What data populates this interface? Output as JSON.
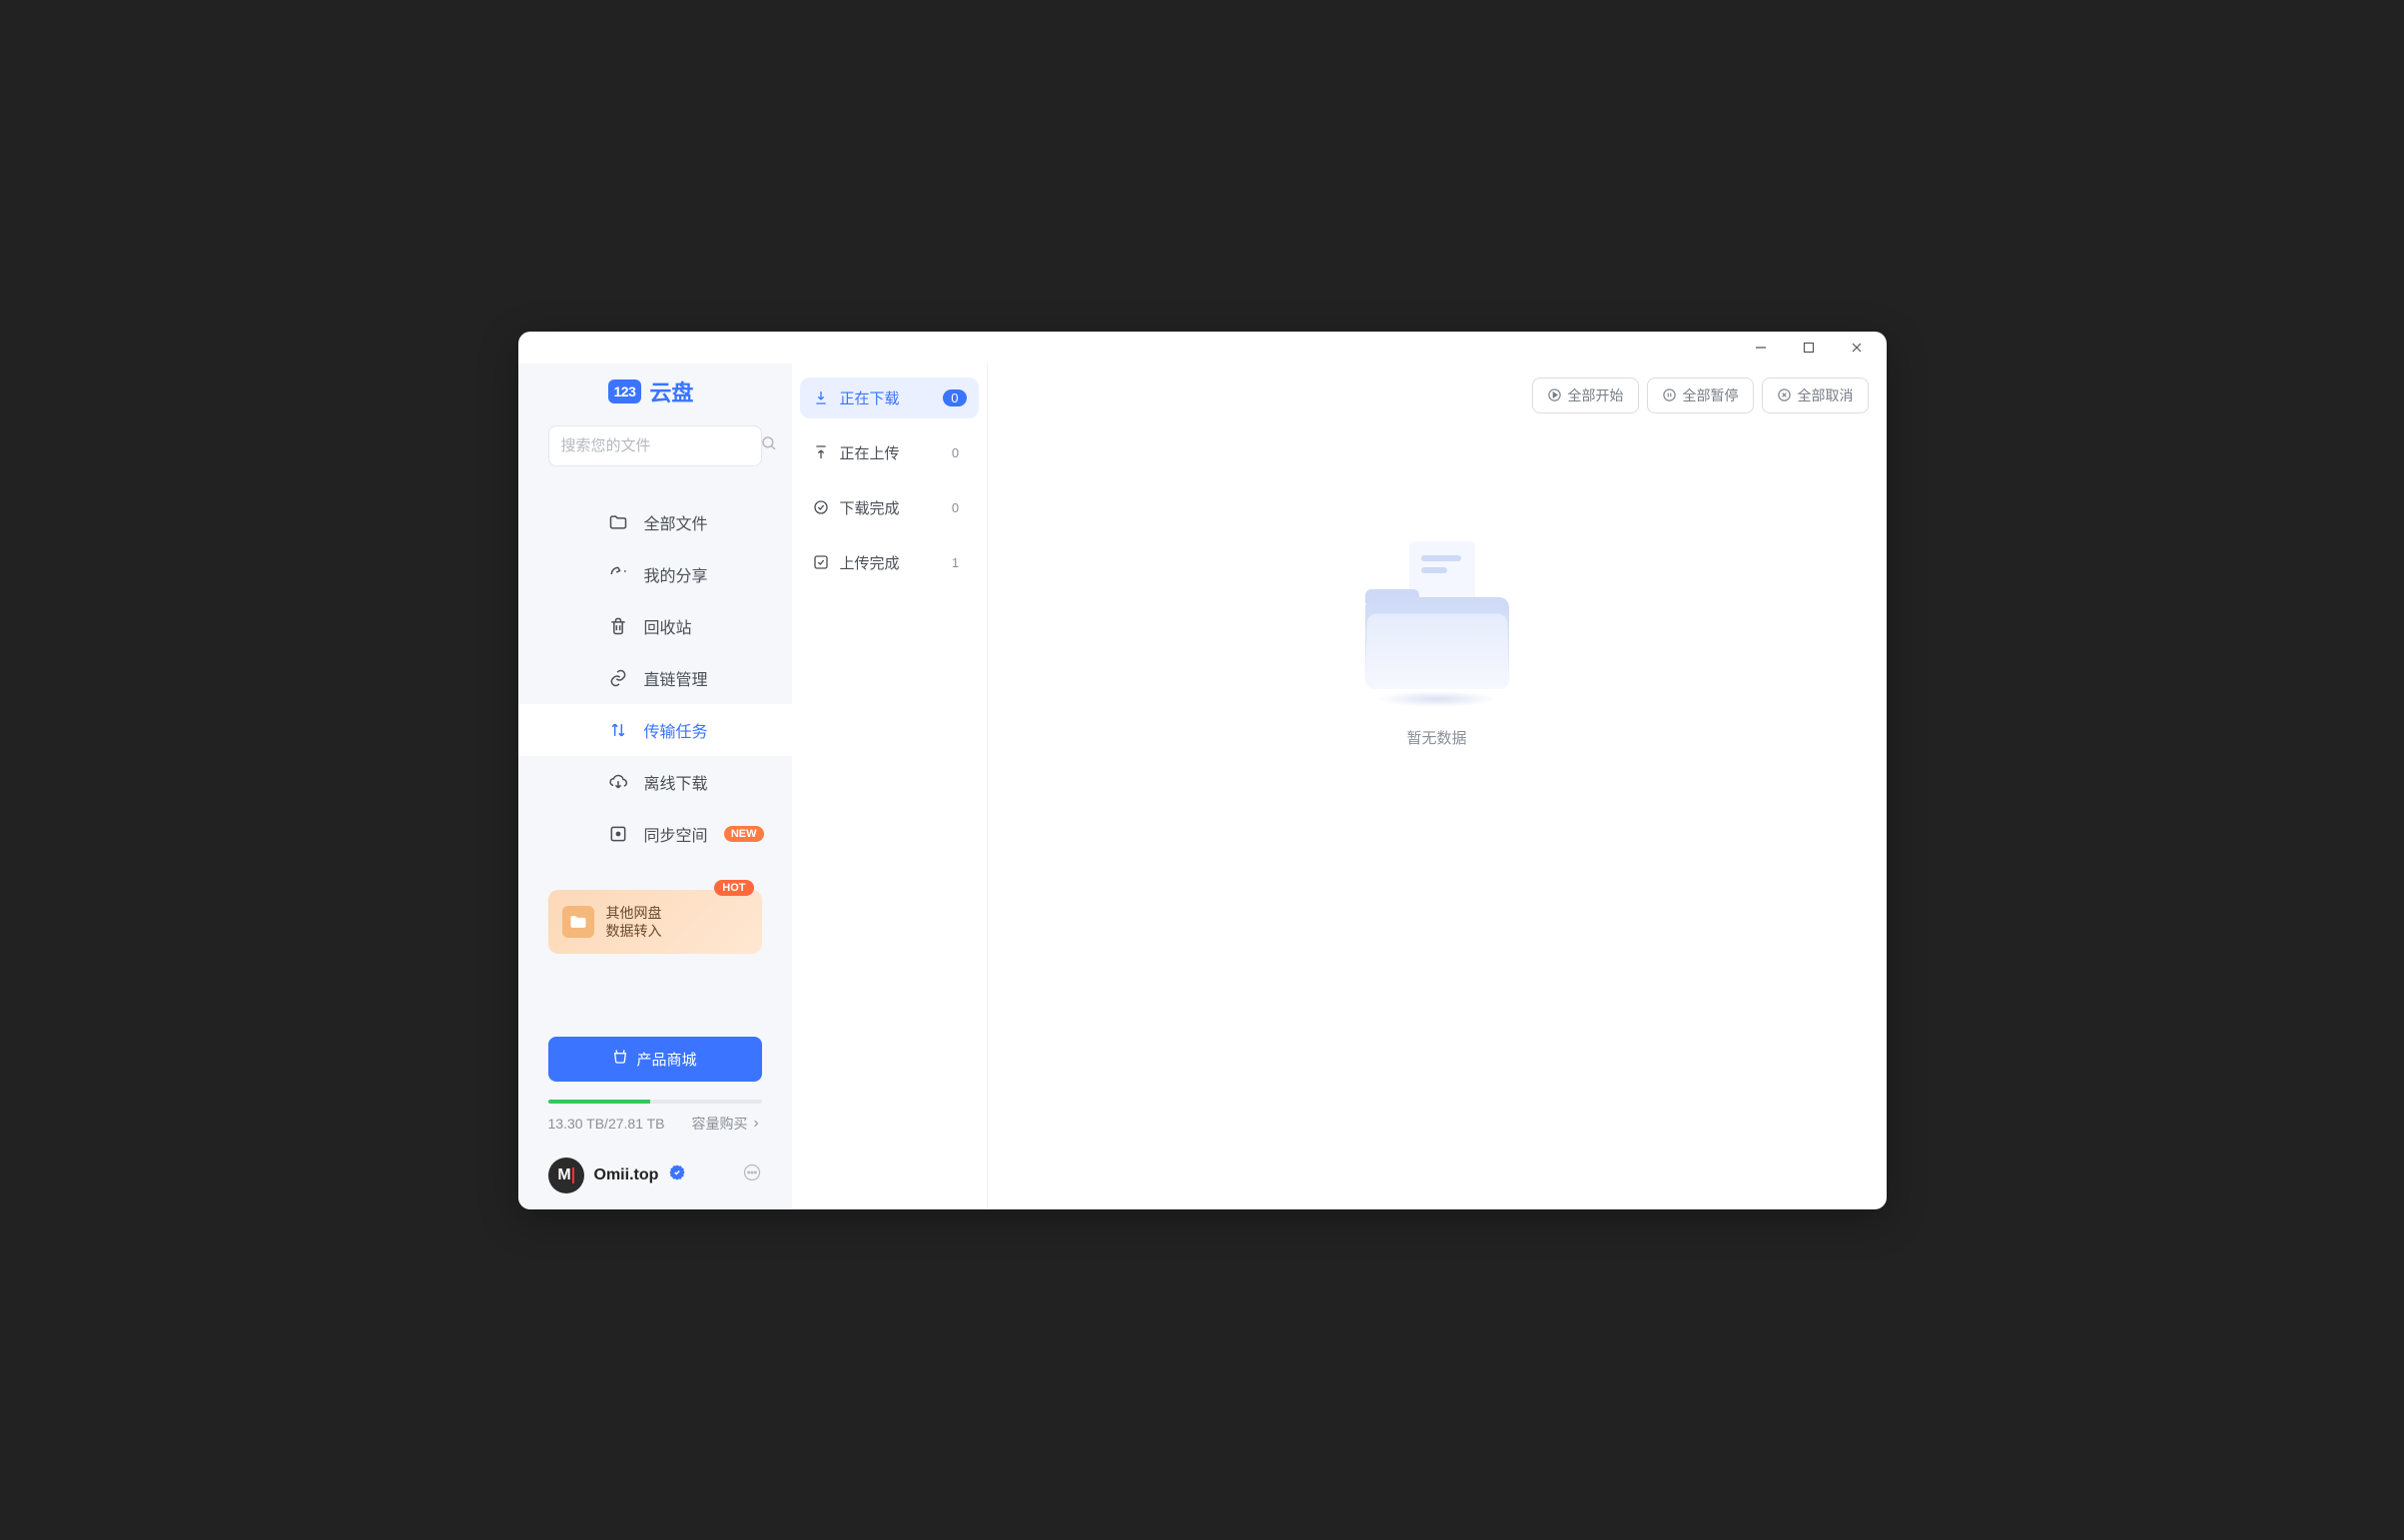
{
  "logo": {
    "badge": "123",
    "text": "云盘"
  },
  "search": {
    "placeholder": "搜索您的文件"
  },
  "nav": {
    "all_files": "全部文件",
    "my_shares": "我的分享",
    "recycle": "回收站",
    "direct_links": "直链管理",
    "transfer_tasks": "传输任务",
    "offline_download": "离线下载",
    "sync_space": "同步空间",
    "sync_badge": "NEW"
  },
  "import_card": {
    "line1": "其他网盘",
    "line2": "数据转入",
    "badge": "HOT"
  },
  "shop_button": "产品商城",
  "storage": {
    "text": "13.30 TB/27.81 TB",
    "buy": "容量购买"
  },
  "user": {
    "name": "Omii.top"
  },
  "tasks": {
    "downloading": {
      "label": "正在下载",
      "count": "0"
    },
    "uploading": {
      "label": "正在上传",
      "count": "0"
    },
    "download_done": {
      "label": "下载完成",
      "count": "0"
    },
    "upload_done": {
      "label": "上传完成",
      "count": "1"
    }
  },
  "toolbar": {
    "start_all": "全部开始",
    "pause_all": "全部暂停",
    "cancel_all": "全部取消"
  },
  "empty": {
    "text": "暂无数据"
  }
}
